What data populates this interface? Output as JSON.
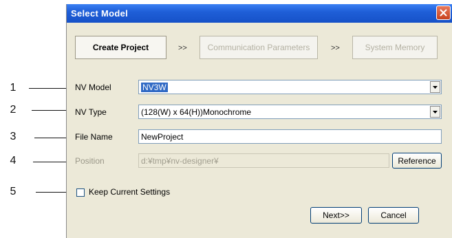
{
  "callouts": [
    "1",
    "2",
    "3",
    "4",
    "5"
  ],
  "dialog": {
    "title": "Select Model",
    "steps": {
      "create_project": "Create Project",
      "sep1": ">>",
      "communication_parameters": "Communication Parameters",
      "sep2": ">>",
      "system_memory": "System Memory"
    },
    "form": {
      "nv_model": {
        "label": "NV Model",
        "value": "NV3W"
      },
      "nv_type": {
        "label": "NV Type",
        "value": "(128(W) x 64(H))Monochrome"
      },
      "file_name": {
        "label": "File Name",
        "value": "NewProject"
      },
      "position": {
        "label": "Position",
        "value": "d:¥tmp¥nv-designer¥",
        "button": "Reference"
      },
      "keep_settings": {
        "label": "Keep Current Settings",
        "checked": false
      }
    },
    "buttons": {
      "next": "Next>>",
      "cancel": "Cancel"
    }
  },
  "colors": {
    "titlebar": "#1f5fd8",
    "selection": "#316ac5",
    "dialog_bg": "#ece9d8"
  }
}
